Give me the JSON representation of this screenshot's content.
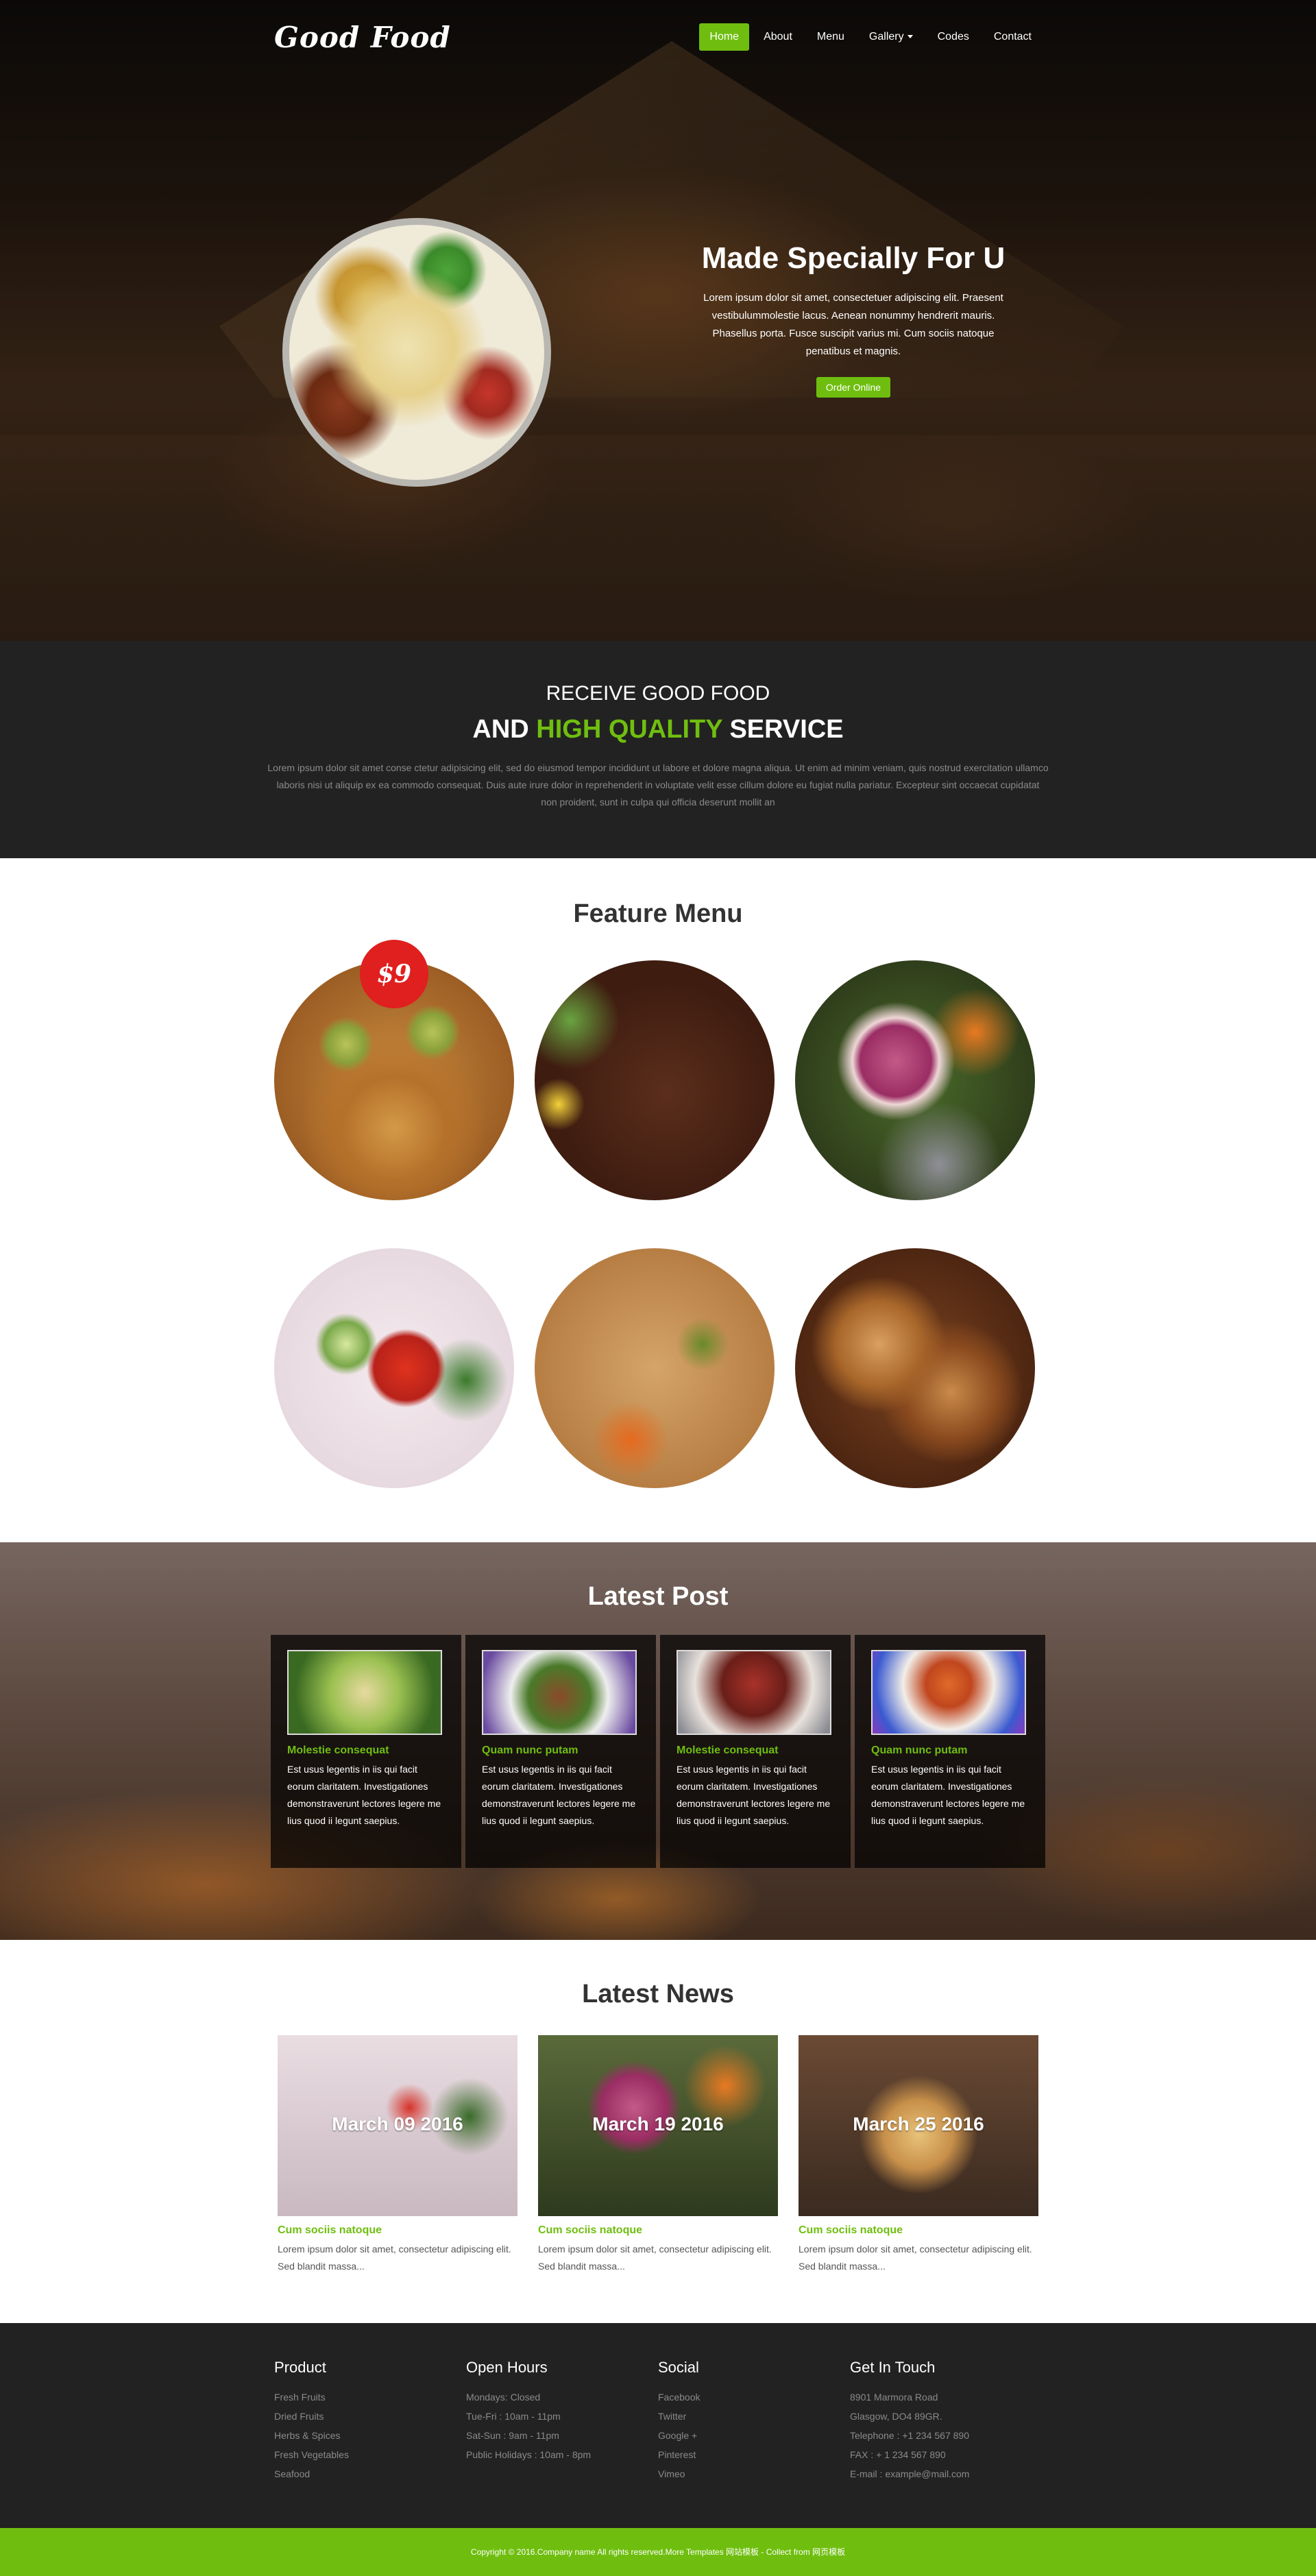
{
  "brand": {
    "logo": "Good Food",
    "accent": "#6fbe0f",
    "price_badge_color": "#e01f1f"
  },
  "nav": {
    "items": [
      {
        "label": "Home",
        "active": true
      },
      {
        "label": "About"
      },
      {
        "label": "Menu"
      },
      {
        "label": "Gallery",
        "dropdown": true
      },
      {
        "label": "Codes"
      },
      {
        "label": "Contact"
      }
    ]
  },
  "hero": {
    "title": "Made Specially For U",
    "description": "Lorem ipsum dolor sit amet, consectetuer adipiscing elit. Praesent vestibulummolestie lacus. Aenean nonummy hendrerit mauris. Phasellus porta. Fusce suscipit varius mi. Cum sociis natoque penatibus et magnis.",
    "button": "Order Online"
  },
  "receive": {
    "line1": "RECEIVE GOOD FOOD",
    "line2_pre": "AND ",
    "line2_green": "HIGH QUALITY",
    "line2_post": " SERVICE",
    "text": "Lorem ipsum dolor sit amet conse ctetur adipisicing elit, sed do eiusmod tempor incididunt ut labore et dolore magna aliqua. Ut enim ad minim veniam, quis nostrud exercitation ullamco laboris nisi ut aliquip ex ea commodo consequat. Duis aute irure dolor in reprehenderit in voluptate velit esse cillum dolore eu fugiat nulla pariatur. Excepteur sint occaecat cupidatat non proident, sunt in culpa qui officia deserunt mollit an"
  },
  "feature": {
    "title_light": "Feature ",
    "title_bold": "Menu",
    "price": "$9",
    "items": [
      {
        "image": "pastry-tarts"
      },
      {
        "image": "grilled-meat"
      },
      {
        "image": "meat-platter"
      },
      {
        "image": "cucumber-tomato-salad"
      },
      {
        "image": "fried-rice"
      },
      {
        "image": "sliced-chicken"
      }
    ]
  },
  "latest_post": {
    "title_light": "Latest ",
    "title_bold": "Post",
    "posts": [
      {
        "title": "Molestie consequat",
        "text": "Est usus legentis in iis qui facit eorum claritatem. Investigationes demonstraverunt lectores legere me lius quod ii legunt saepius."
      },
      {
        "title": "Quam nunc putam",
        "text": "Est usus legentis in iis qui facit eorum claritatem. Investigationes demonstraverunt lectores legere me lius quod ii legunt saepius."
      },
      {
        "title": "Molestie consequat",
        "text": "Est usus legentis in iis qui facit eorum claritatem. Investigationes demonstraverunt lectores legere me lius quod ii legunt saepius."
      },
      {
        "title": "Quam nunc putam",
        "text": "Est usus legentis in iis qui facit eorum claritatem. Investigationes demonstraverunt lectores legere me lius quod ii legunt saepius."
      }
    ]
  },
  "latest_news": {
    "title_light": "Latest ",
    "title_bold": "News",
    "items": [
      {
        "date": "March 09 2016",
        "title": "Cum sociis natoque",
        "text": "Lorem ipsum dolor sit amet, consectetur adipiscing elit. Sed blandit massa..."
      },
      {
        "date": "March 19 2016",
        "title": "Cum sociis natoque",
        "text": "Lorem ipsum dolor sit amet, consectetur adipiscing elit. Sed blandit massa..."
      },
      {
        "date": "March 25 2016",
        "title": "Cum sociis natoque",
        "text": "Lorem ipsum dolor sit amet, consectetur adipiscing elit. Sed blandit massa..."
      }
    ]
  },
  "footer": {
    "product": {
      "title": "Product",
      "items": [
        "Fresh Fruits",
        "Dried Fruits",
        "Herbs & Spices",
        "Fresh Vegetables",
        "Seafood"
      ]
    },
    "hours": {
      "title": "Open Hours",
      "items": [
        "Mondays: Closed",
        "Tue-Fri : 10am - 11pm",
        "Sat-Sun : 9am - 11pm",
        "Public Holidays : 10am - 8pm"
      ]
    },
    "social": {
      "title": "Social",
      "items": [
        "Facebook",
        "Twitter",
        "Google +",
        "Pinterest",
        "Vimeo"
      ]
    },
    "contact": {
      "title": "Get In Touch",
      "items": [
        "8901 Marmora Road",
        "Glasgow, DO4 89GR.",
        "Telephone : +1 234 567 890",
        "FAX : + 1 234 567 890",
        "E-mail : example@mail.com"
      ]
    },
    "copyright": "Copyright © 2016.Company name All rights reserved.More Templates 网站模板 - Collect from 网页模板"
  }
}
